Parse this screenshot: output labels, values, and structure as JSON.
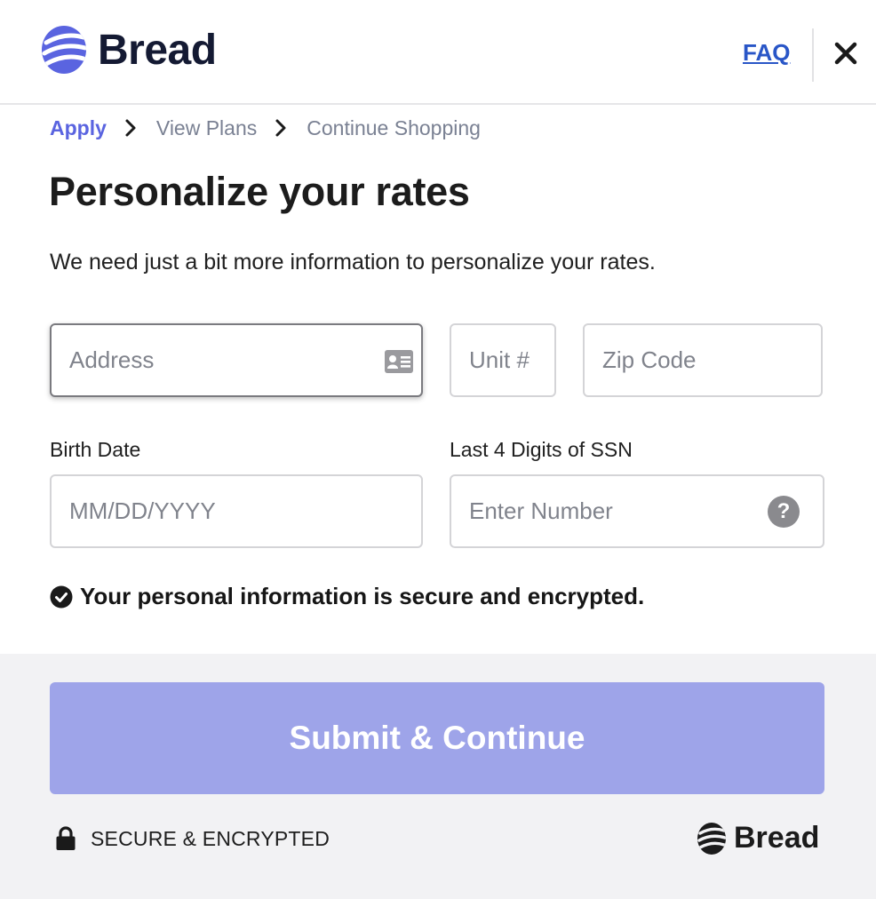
{
  "header": {
    "brand_name": "Bread",
    "faq_label": "FAQ",
    "close_label": "Close"
  },
  "breadcrumb": {
    "items": [
      "Apply",
      "View Plans",
      "Continue Shopping"
    ]
  },
  "main": {
    "title": "Personalize your rates",
    "subtitle": "We need just a bit more information to personalize your rates.",
    "address": {
      "placeholder": "Address",
      "value": ""
    },
    "unit": {
      "placeholder": "Unit #",
      "value": ""
    },
    "zip": {
      "placeholder": "Zip Code",
      "value": ""
    },
    "birth_date": {
      "label": "Birth Date",
      "placeholder": "MM/DD/YYYY",
      "value": ""
    },
    "ssn": {
      "label": "Last 4 Digits of SSN",
      "placeholder": "Enter Number",
      "value": "",
      "help_glyph": "?"
    },
    "secure_note": "Your personal information is secure and encrypted."
  },
  "footer": {
    "submit_label": "Submit & Continue",
    "secure_label": "SECURE & ENCRYPTED",
    "brand_name": "Bread"
  },
  "colors": {
    "brand_purple": "#5a64e0",
    "submit_disabled": "#9ea4e9",
    "faq_link": "#2956c7",
    "footer_bg": "#f2f2f4"
  },
  "icons": {
    "logo": "bread-logo-icon",
    "close": "close-icon",
    "chevron": "chevron-right-icon",
    "address": "id-card-icon",
    "help": "question-circle-icon",
    "check": "check-circle-icon",
    "lock": "lock-icon"
  }
}
